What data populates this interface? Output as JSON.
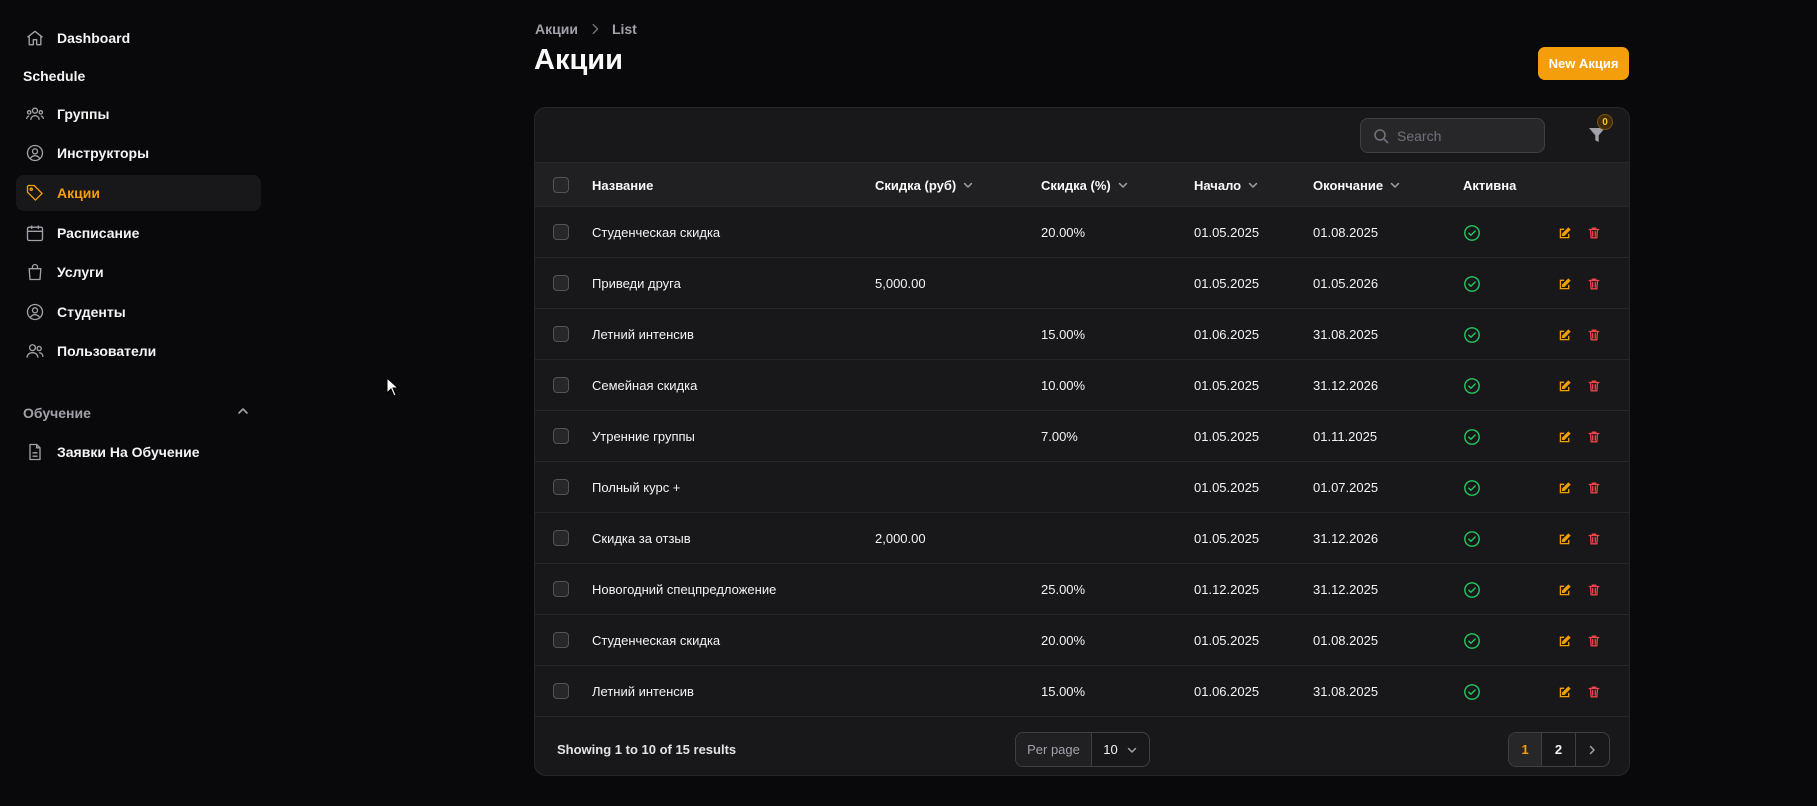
{
  "sidebar": {
    "dashboard": "Dashboard",
    "schedule_group": "Schedule",
    "items": [
      {
        "label": "Группы",
        "icon": "users-group-icon"
      },
      {
        "label": "Инструкторы",
        "icon": "user-circle-icon"
      },
      {
        "label": "Акции",
        "icon": "tag-icon"
      },
      {
        "label": "Расписание",
        "icon": "calendar-icon"
      },
      {
        "label": "Услуги",
        "icon": "shopping-bag-icon"
      },
      {
        "label": "Студенты",
        "icon": "user-circle-icon"
      },
      {
        "label": "Пользователи",
        "icon": "users-icon"
      }
    ],
    "active_item": "Акции",
    "learning_group": "Обучение",
    "learning_items": [
      {
        "label": "Заявки На Обучение",
        "icon": "document-icon"
      }
    ]
  },
  "breadcrumb": {
    "root": "Акции",
    "current": "List"
  },
  "page": {
    "title": "Акции",
    "new_button": "New Акция"
  },
  "table": {
    "search_placeholder": "Search",
    "filter_count": "0",
    "columns": {
      "name": "Название",
      "discount_rub": "Скидка (руб)",
      "discount_pct": "Скидка (%)",
      "start": "Начало",
      "end": "Окончание",
      "active": "Активна"
    },
    "rows": [
      {
        "name": "Студенческая скидка",
        "discount_rub": "",
        "discount_pct": "20.00%",
        "start": "01.05.2025",
        "end": "01.08.2025",
        "active": true
      },
      {
        "name": "Приведи друга",
        "discount_rub": "5,000.00",
        "discount_pct": "",
        "start": "01.05.2025",
        "end": "01.05.2026",
        "active": true
      },
      {
        "name": "Летний интенсив",
        "discount_rub": "",
        "discount_pct": "15.00%",
        "start": "01.06.2025",
        "end": "31.08.2025",
        "active": true
      },
      {
        "name": "Семейная скидка",
        "discount_rub": "",
        "discount_pct": "10.00%",
        "start": "01.05.2025",
        "end": "31.12.2026",
        "active": true
      },
      {
        "name": "Утренние группы",
        "discount_rub": "",
        "discount_pct": "7.00%",
        "start": "01.05.2025",
        "end": "01.11.2025",
        "active": true
      },
      {
        "name": "Полный курс +",
        "discount_rub": "",
        "discount_pct": "",
        "start": "01.05.2025",
        "end": "01.07.2025",
        "active": true
      },
      {
        "name": "Скидка за отзыв",
        "discount_rub": "2,000.00",
        "discount_pct": "",
        "start": "01.05.2025",
        "end": "31.12.2026",
        "active": true
      },
      {
        "name": "Новогодний спецпредложение",
        "discount_rub": "",
        "discount_pct": "25.00%",
        "start": "01.12.2025",
        "end": "31.12.2025",
        "active": true
      },
      {
        "name": "Студенческая скидка",
        "discount_rub": "",
        "discount_pct": "20.00%",
        "start": "01.05.2025",
        "end": "01.08.2025",
        "active": true
      },
      {
        "name": "Летний интенсив",
        "discount_rub": "",
        "discount_pct": "15.00%",
        "start": "01.06.2025",
        "end": "31.08.2025",
        "active": true
      }
    ],
    "footer": {
      "results_text": "Showing 1 to 10 of 15 results",
      "per_page_label": "Per page",
      "per_page_value": "10",
      "pages": [
        "1",
        "2"
      ],
      "current_page": "1"
    }
  },
  "colors": {
    "accent": "#f59e0b",
    "success": "#22c55e",
    "danger": "#ef4444",
    "background": "#09090b",
    "card": "#18181b"
  }
}
